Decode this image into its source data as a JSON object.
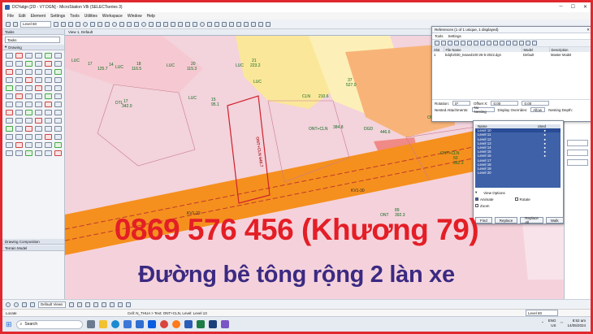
{
  "app": {
    "title": "DC%dgn [2D - V7 DGN] - MicroStation V8i (SELECTseries 3)",
    "menus": [
      "File",
      "Edit",
      "Element",
      "Settings",
      "Tools",
      "Utilities",
      "Workspace",
      "Window",
      "Help"
    ],
    "level_select": "Level 60"
  },
  "left_panel": {
    "tasks_title": "Tasks",
    "tasks_select": "Tasks",
    "drawing_title": "Drawing",
    "drawing_composition": "Drawing Composition",
    "terrain_model": "Terrain Model"
  },
  "view": {
    "title": "View 1, Default"
  },
  "map_labels": {
    "lucs": [
      "LUC",
      "LUC",
      "LUC",
      "LUC",
      "LUC",
      "LUC",
      "LUC"
    ],
    "numbers_a": [
      "18",
      "116.5",
      "20",
      "115.3",
      "14",
      "125.7",
      "15",
      "95.1",
      "21",
      "223.2",
      "37",
      "527.0",
      "17",
      "342.0"
    ],
    "cln": [
      "CLN",
      "CLN",
      "ONT+CLN",
      "ONT+CLN",
      "DGD",
      "ONT"
    ],
    "numbers_b": [
      "210.6",
      "446.6",
      "384.8",
      "60",
      "392.3",
      "89",
      "392.3"
    ],
    "parcel": "ONT+CLN 640.7",
    "road_a": "KV1-30",
    "road_b": "KV1-22",
    "lt_label": "ONT",
    "dtl": "DTL"
  },
  "references": {
    "title": "References (1 of 1 unique, 1 displayed)",
    "menu": [
      "Tools",
      "Settings"
    ],
    "columns": [
      "Slot",
      "File Name",
      "Model",
      "Description"
    ],
    "row": {
      "slot": "1",
      "file": "bdqh2030_tvsaed100-26-5-2022.dgn",
      "model": "Default",
      "description": "Master Model"
    },
    "rotation_label": "Rotation:",
    "rotation_value": "0*",
    "offset_label": "Offset X:",
    "offset_x": "0.00",
    "offset_y": "0.00",
    "nested_label": "Nested Attachments:",
    "nested_value": "No Nesting",
    "display_overrides": "Display Overrides:",
    "overrides_value": "Allow",
    "nesting_depth": "Nesting Depth:",
    "locate": "Locate"
  },
  "level_list": {
    "header_name": "Name",
    "header_used": "Used",
    "items": [
      "Level 10",
      "Level 11",
      "Level 12",
      "Level 13",
      "Level 14",
      "Level 15",
      "Level 16",
      "Level 17",
      "Level 18",
      "Level 19",
      "Level 20"
    ],
    "view_options": "View Options",
    "animate": "Animate",
    "rotate": "Rotate",
    "zoom": "Zoom",
    "buttons": [
      "Find",
      "Replace",
      "Replace All",
      "Walk"
    ]
  },
  "status": {
    "left": "Locate",
    "message": "Cell: N_THUA > Text: ONT+CLN, Level: Level 13",
    "views_select": "Default Views",
    "level": "Level 60"
  },
  "taskbar": {
    "search_placeholder": "Search",
    "lang": "ENG",
    "region": "US",
    "time": "8:52 am",
    "date": "14/05/2024"
  },
  "overlay": {
    "phone": "0869 576 456 (Khương 79)",
    "caption": "Đường bê tông rộng 2 làn xe"
  },
  "colors": {
    "frame": "#e0282e",
    "phone_text": "#e41e26",
    "caption_text": "#3b2a82",
    "road": "#f5901e",
    "pink_land": "#f3d3dc",
    "yellow_land": "#fbe79a"
  }
}
